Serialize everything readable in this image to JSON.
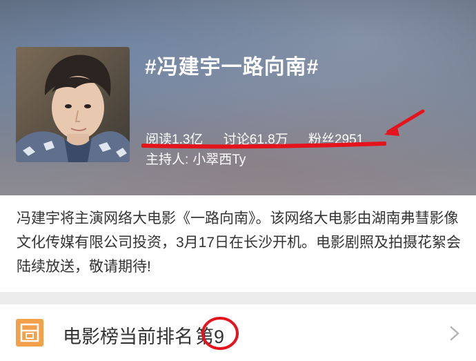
{
  "topic": {
    "title": "#冯建宇一路向南#",
    "stats": {
      "reads": "阅读1.3亿",
      "discussions": "讨论61.8万",
      "fans": "粉丝2951"
    },
    "host_label": "主持人:",
    "host_name": "小翠西Ty",
    "avatar_icon": "person-photo-icon"
  },
  "description": {
    "text": "冯建宇将主演网络大电影《一路向南》。该网络大电影由湖南弗彗影像文化传媒有限公司投资，3月17日在长沙开机。电影剧照及拍摄花絮会陆续放送，敬请期待!"
  },
  "ranking": {
    "icon": "movie-icon",
    "label": "电影榜当前排名",
    "value": "第9",
    "chevron_icon": "chevron-right-icon"
  },
  "colors": {
    "annotation_red": "#e5131b",
    "rank_icon_bg": "#f2a14a",
    "text_dark": "#333333"
  }
}
